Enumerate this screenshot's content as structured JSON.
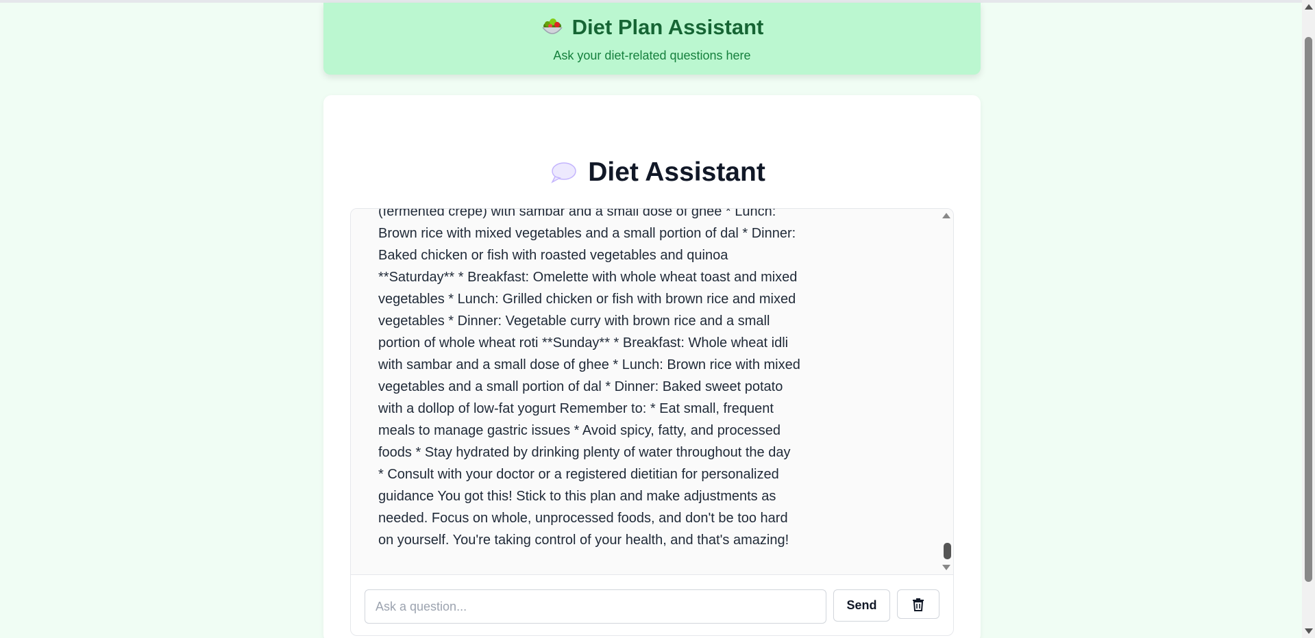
{
  "header": {
    "title": "Diet Plan Assistant",
    "subtitle": "Ask your diet-related questions here",
    "icon": "salad-icon"
  },
  "assistant": {
    "title": "Diet Assistant",
    "icon": "speech-bubble-icon"
  },
  "messages": [
    {
      "role": "assistant",
      "lines": [
        "(fermented crepe) with sambar and a small dose of ghee * Lunch:",
        "Brown rice with mixed vegetables and a small portion of dal * Dinner:",
        "Baked chicken or fish with roasted vegetables and quinoa",
        "**Saturday** * Breakfast: Omelette with whole wheat toast and mixed",
        "vegetables * Lunch: Grilled chicken or fish with brown rice and mixed",
        "vegetables * Dinner: Vegetable curry with brown rice and a small",
        "portion of whole wheat roti **Sunday** * Breakfast: Whole wheat idli",
        "with sambar and a small dose of ghee * Lunch: Brown rice with mixed",
        "vegetables and a small portion of dal * Dinner: Baked sweet potato",
        "with a dollop of low-fat yogurt Remember to: * Eat small, frequent",
        "meals to manage gastric issues * Avoid spicy, fatty, and processed",
        "foods * Stay hydrated by drinking plenty of water throughout the day",
        "* Consult with your doctor or a registered dietitian for personalized",
        "guidance You got this! Stick to this plan and make adjustments as",
        "needed. Focus on whole, unprocessed foods, and don't be too hard",
        "on yourself. You're taking control of your health, and that's amazing!"
      ]
    }
  ],
  "input": {
    "placeholder": "Ask a question...",
    "value": ""
  },
  "buttons": {
    "send_label": "Send",
    "clear_icon": "trash-icon"
  },
  "colors": {
    "page_bg": "#f0fdf4",
    "header_bg": "#bbf7d0",
    "header_title": "#166534",
    "header_subtitle": "#15803d"
  }
}
